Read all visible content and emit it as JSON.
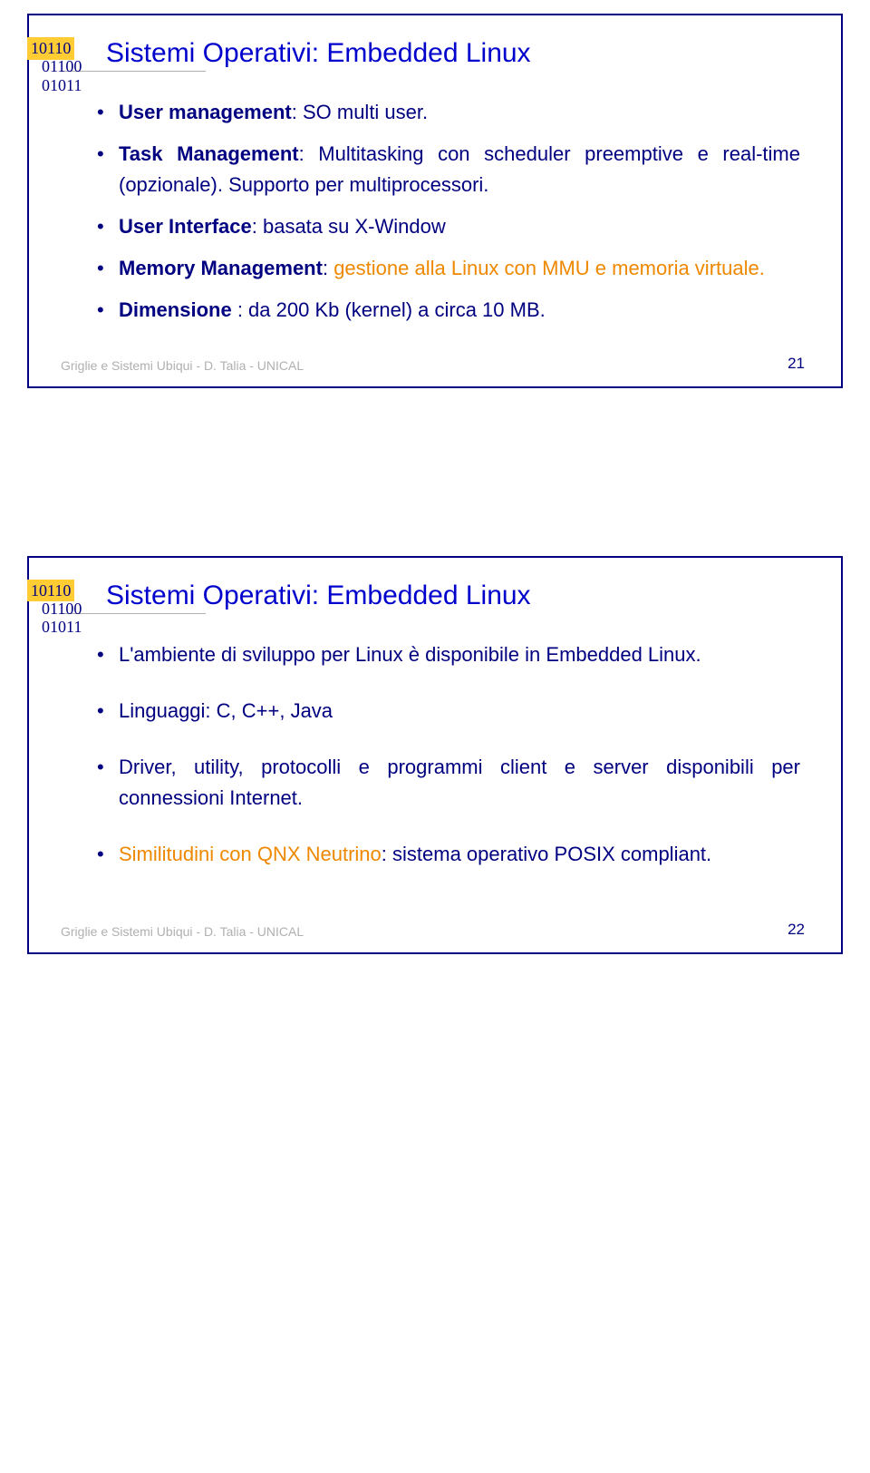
{
  "binary": {
    "line1": "10110",
    "line2": "01100",
    "line3": "01011"
  },
  "slide1": {
    "title": "Sistemi Operativi: Embedded Linux",
    "bullets": {
      "b1": {
        "label": "User management",
        "text": ": SO multi user."
      },
      "b2": {
        "label": "Task Management",
        "text_pre": ": Multitasking con scheduler preemptive e real-time (opzionale). Supporto per multiprocessori."
      },
      "b3": {
        "label": "User Interface",
        "text": ": basata su X-Window"
      },
      "b4": {
        "label": "Memory Management",
        "text_pre": ": ",
        "orange": "gestione alla Linux con MMU e memoria virtuale."
      },
      "b5": {
        "label": "Dimensione ",
        "text": ": da 200 Kb (kernel) a circa 10 MB."
      }
    },
    "footer_left": "Griglie e Sistemi Ubiqui - D. Talia - UNICAL",
    "footer_page": "21"
  },
  "slide2": {
    "title": "Sistemi Operativi: Embedded Linux",
    "bullets": {
      "b1": "L'ambiente di sviluppo per Linux è disponibile in Embedded Linux.",
      "b2": "Linguaggi: C, C++, Java",
      "b3": "Driver, utility, protocolli e programmi client e server disponibili per connessioni Internet.",
      "b4_orange": "Similitudini con QNX Neutrino",
      "b4_rest": ": sistema operativo POSIX compliant."
    },
    "footer_left": "Griglie e Sistemi Ubiqui - D. Talia - UNICAL",
    "footer_page": "22"
  }
}
